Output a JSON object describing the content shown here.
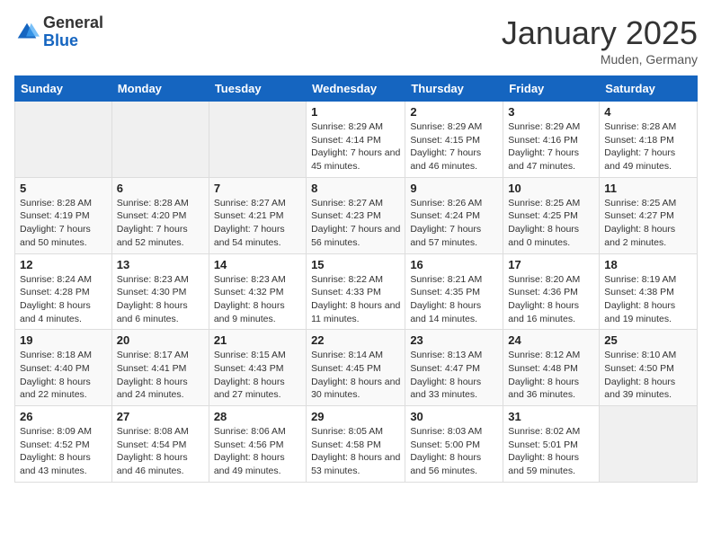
{
  "header": {
    "logo_general": "General",
    "logo_blue": "Blue",
    "month_title": "January 2025",
    "location": "Muden, Germany"
  },
  "days_of_week": [
    "Sunday",
    "Monday",
    "Tuesday",
    "Wednesday",
    "Thursday",
    "Friday",
    "Saturday"
  ],
  "weeks": [
    [
      {
        "day": "",
        "sunrise": "",
        "sunset": "",
        "daylight": ""
      },
      {
        "day": "",
        "sunrise": "",
        "sunset": "",
        "daylight": ""
      },
      {
        "day": "",
        "sunrise": "",
        "sunset": "",
        "daylight": ""
      },
      {
        "day": "1",
        "sunrise": "Sunrise: 8:29 AM",
        "sunset": "Sunset: 4:14 PM",
        "daylight": "Daylight: 7 hours and 45 minutes."
      },
      {
        "day": "2",
        "sunrise": "Sunrise: 8:29 AM",
        "sunset": "Sunset: 4:15 PM",
        "daylight": "Daylight: 7 hours and 46 minutes."
      },
      {
        "day": "3",
        "sunrise": "Sunrise: 8:29 AM",
        "sunset": "Sunset: 4:16 PM",
        "daylight": "Daylight: 7 hours and 47 minutes."
      },
      {
        "day": "4",
        "sunrise": "Sunrise: 8:28 AM",
        "sunset": "Sunset: 4:18 PM",
        "daylight": "Daylight: 7 hours and 49 minutes."
      }
    ],
    [
      {
        "day": "5",
        "sunrise": "Sunrise: 8:28 AM",
        "sunset": "Sunset: 4:19 PM",
        "daylight": "Daylight: 7 hours and 50 minutes."
      },
      {
        "day": "6",
        "sunrise": "Sunrise: 8:28 AM",
        "sunset": "Sunset: 4:20 PM",
        "daylight": "Daylight: 7 hours and 52 minutes."
      },
      {
        "day": "7",
        "sunrise": "Sunrise: 8:27 AM",
        "sunset": "Sunset: 4:21 PM",
        "daylight": "Daylight: 7 hours and 54 minutes."
      },
      {
        "day": "8",
        "sunrise": "Sunrise: 8:27 AM",
        "sunset": "Sunset: 4:23 PM",
        "daylight": "Daylight: 7 hours and 56 minutes."
      },
      {
        "day": "9",
        "sunrise": "Sunrise: 8:26 AM",
        "sunset": "Sunset: 4:24 PM",
        "daylight": "Daylight: 7 hours and 57 minutes."
      },
      {
        "day": "10",
        "sunrise": "Sunrise: 8:25 AM",
        "sunset": "Sunset: 4:25 PM",
        "daylight": "Daylight: 8 hours and 0 minutes."
      },
      {
        "day": "11",
        "sunrise": "Sunrise: 8:25 AM",
        "sunset": "Sunset: 4:27 PM",
        "daylight": "Daylight: 8 hours and 2 minutes."
      }
    ],
    [
      {
        "day": "12",
        "sunrise": "Sunrise: 8:24 AM",
        "sunset": "Sunset: 4:28 PM",
        "daylight": "Daylight: 8 hours and 4 minutes."
      },
      {
        "day": "13",
        "sunrise": "Sunrise: 8:23 AM",
        "sunset": "Sunset: 4:30 PM",
        "daylight": "Daylight: 8 hours and 6 minutes."
      },
      {
        "day": "14",
        "sunrise": "Sunrise: 8:23 AM",
        "sunset": "Sunset: 4:32 PM",
        "daylight": "Daylight: 8 hours and 9 minutes."
      },
      {
        "day": "15",
        "sunrise": "Sunrise: 8:22 AM",
        "sunset": "Sunset: 4:33 PM",
        "daylight": "Daylight: 8 hours and 11 minutes."
      },
      {
        "day": "16",
        "sunrise": "Sunrise: 8:21 AM",
        "sunset": "Sunset: 4:35 PM",
        "daylight": "Daylight: 8 hours and 14 minutes."
      },
      {
        "day": "17",
        "sunrise": "Sunrise: 8:20 AM",
        "sunset": "Sunset: 4:36 PM",
        "daylight": "Daylight: 8 hours and 16 minutes."
      },
      {
        "day": "18",
        "sunrise": "Sunrise: 8:19 AM",
        "sunset": "Sunset: 4:38 PM",
        "daylight": "Daylight: 8 hours and 19 minutes."
      }
    ],
    [
      {
        "day": "19",
        "sunrise": "Sunrise: 8:18 AM",
        "sunset": "Sunset: 4:40 PM",
        "daylight": "Daylight: 8 hours and 22 minutes."
      },
      {
        "day": "20",
        "sunrise": "Sunrise: 8:17 AM",
        "sunset": "Sunset: 4:41 PM",
        "daylight": "Daylight: 8 hours and 24 minutes."
      },
      {
        "day": "21",
        "sunrise": "Sunrise: 8:15 AM",
        "sunset": "Sunset: 4:43 PM",
        "daylight": "Daylight: 8 hours and 27 minutes."
      },
      {
        "day": "22",
        "sunrise": "Sunrise: 8:14 AM",
        "sunset": "Sunset: 4:45 PM",
        "daylight": "Daylight: 8 hours and 30 minutes."
      },
      {
        "day": "23",
        "sunrise": "Sunrise: 8:13 AM",
        "sunset": "Sunset: 4:47 PM",
        "daylight": "Daylight: 8 hours and 33 minutes."
      },
      {
        "day": "24",
        "sunrise": "Sunrise: 8:12 AM",
        "sunset": "Sunset: 4:48 PM",
        "daylight": "Daylight: 8 hours and 36 minutes."
      },
      {
        "day": "25",
        "sunrise": "Sunrise: 8:10 AM",
        "sunset": "Sunset: 4:50 PM",
        "daylight": "Daylight: 8 hours and 39 minutes."
      }
    ],
    [
      {
        "day": "26",
        "sunrise": "Sunrise: 8:09 AM",
        "sunset": "Sunset: 4:52 PM",
        "daylight": "Daylight: 8 hours and 43 minutes."
      },
      {
        "day": "27",
        "sunrise": "Sunrise: 8:08 AM",
        "sunset": "Sunset: 4:54 PM",
        "daylight": "Daylight: 8 hours and 46 minutes."
      },
      {
        "day": "28",
        "sunrise": "Sunrise: 8:06 AM",
        "sunset": "Sunset: 4:56 PM",
        "daylight": "Daylight: 8 hours and 49 minutes."
      },
      {
        "day": "29",
        "sunrise": "Sunrise: 8:05 AM",
        "sunset": "Sunset: 4:58 PM",
        "daylight": "Daylight: 8 hours and 53 minutes."
      },
      {
        "day": "30",
        "sunrise": "Sunrise: 8:03 AM",
        "sunset": "Sunset: 5:00 PM",
        "daylight": "Daylight: 8 hours and 56 minutes."
      },
      {
        "day": "31",
        "sunrise": "Sunrise: 8:02 AM",
        "sunset": "Sunset: 5:01 PM",
        "daylight": "Daylight: 8 hours and 59 minutes."
      },
      {
        "day": "",
        "sunrise": "",
        "sunset": "",
        "daylight": ""
      }
    ]
  ]
}
